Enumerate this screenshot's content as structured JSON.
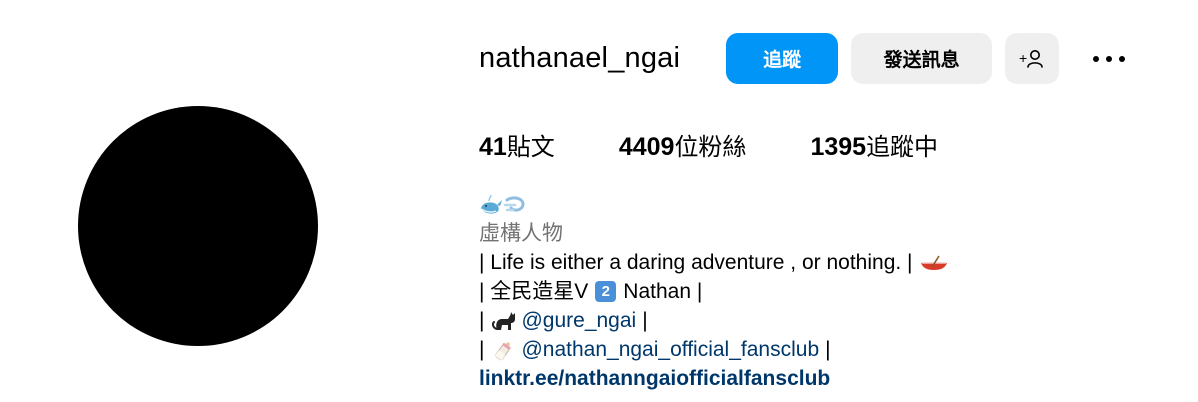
{
  "profile": {
    "username": "nathanael_ngai",
    "avatar_color": "#000000"
  },
  "actions": {
    "follow_label": "追蹤",
    "message_label": "發送訊息",
    "add_user_icon": "add-user-icon",
    "more_icon": "more-horizontal-icon"
  },
  "stats": {
    "posts_count": "41",
    "posts_label": "貼文",
    "followers_count": "4409",
    "followers_label": "位粉絲",
    "following_count": "1395",
    "following_label": "追蹤中"
  },
  "bio": {
    "emoji_header_icons": [
      "whale-icon",
      "dash-icon"
    ],
    "category": "虛構人物",
    "line1_prefix": "| Life is either a daring adventure , or nothing. |",
    "line1_icon": "canoe-icon",
    "line2_a": "| 全民造星V",
    "line2_badge": "2",
    "line2_b": "Nathan |",
    "line3_prefix": "|",
    "line3_icon": "cat-icon",
    "line3_mention": "@gure_ngai",
    "line3_suffix": "|",
    "line4_prefix": "|",
    "line4_icon": "baby-bottle-icon",
    "line4_mention": "@nathan_ngai_official_fansclub",
    "line4_suffix": "|",
    "link": "linktr.ee/nathanngaiofficialfansclub"
  },
  "colors": {
    "accent": "#0095f6",
    "secondary_button": "#efefef",
    "link": "#00376b",
    "muted_text": "#737373"
  }
}
